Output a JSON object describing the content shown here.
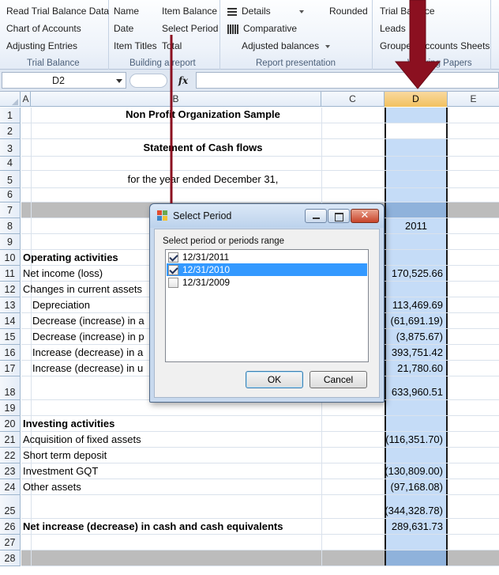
{
  "ribbon": {
    "groups": [
      {
        "label": "Trial Balance",
        "items": [
          "Read Trial Balance Data",
          "Chart of Accounts",
          "Adjusting Entries"
        ]
      },
      {
        "label": "Building a report",
        "col1": [
          "Name",
          "Date",
          "Item Titles"
        ],
        "col2": [
          "Item Balance",
          "Select Period",
          "Total"
        ]
      },
      {
        "label": "Report presentation",
        "items": [
          "Details",
          "Comparative",
          "Adjusted balances"
        ],
        "rounded": "Rounded"
      },
      {
        "label": "Working Papers",
        "items": [
          "Trial Balance",
          "Leads",
          "Grouped Accounts Sheets"
        ]
      }
    ],
    "icons": {
      "details": "lines-icon",
      "comparative": "bars-icon"
    }
  },
  "formula_bar": {
    "name_box": "D2",
    "fx_label": "fx",
    "formula": ""
  },
  "grid": {
    "columns": [
      "A",
      "B",
      "C",
      "D",
      "E"
    ],
    "selected_column": "D",
    "rows": [
      {
        "n": "1",
        "b": "Non Profit Organization Sample",
        "b_style": "center-bold",
        "d": ""
      },
      {
        "n": "2",
        "b": "",
        "d": ""
      },
      {
        "n": "3",
        "b": "Statement of Cash flows",
        "b_style": "center-bold",
        "d": ""
      },
      {
        "n": "4",
        "b": "",
        "d": ""
      },
      {
        "n": "5",
        "b": "for the year ended December 31,",
        "b_style": "center",
        "d": ""
      },
      {
        "n": "6",
        "b": "",
        "d": ""
      },
      {
        "n": "7",
        "b": "",
        "d": ""
      },
      {
        "n": "8",
        "b": "",
        "d": "2011"
      },
      {
        "n": "9",
        "b": "",
        "d": ""
      },
      {
        "n": "10",
        "b": "Operating activities",
        "b_style": "bold",
        "d": ""
      },
      {
        "n": "11",
        "b": "Net income (loss)",
        "d": "170,525.66"
      },
      {
        "n": "12",
        "b": "Changes in current assets",
        "d": ""
      },
      {
        "n": "13",
        "b": "Depreciation",
        "b_style": "indent",
        "d": "113,469.69"
      },
      {
        "n": "14",
        "b": "Decrease (increase) in a",
        "b_style": "indent",
        "d": "(61,691.19)"
      },
      {
        "n": "15",
        "b": "Decrease (increase) in p",
        "b_style": "indent",
        "d": "(3,875.67)"
      },
      {
        "n": "16",
        "b": "Increase (decrease) in a",
        "b_style": "indent",
        "d": "393,751.42"
      },
      {
        "n": "17",
        "b": "Increase (decrease) in u",
        "b_style": "indent",
        "d": "21,780.60"
      },
      {
        "n": "18",
        "b": "",
        "d": "633,960.51"
      },
      {
        "n": "19",
        "b": "",
        "d": ""
      },
      {
        "n": "20",
        "b": "Investing activities",
        "b_style": "bold",
        "d": ""
      },
      {
        "n": "21",
        "b": "Acquisition of fixed assets",
        "d": "(116,351.70)"
      },
      {
        "n": "22",
        "b": "Short term deposit",
        "d": ""
      },
      {
        "n": "23",
        "b": "Investment GQT",
        "d": "(130,809.00)"
      },
      {
        "n": "24",
        "b": "Other assets",
        "d": "(97,168.08)"
      },
      {
        "n": "25",
        "b": "",
        "d": "(344,328.78)"
      },
      {
        "n": "26",
        "b": "Net increase (decrease) in cash and cash equivalents",
        "b_style": "bold",
        "d": "289,631.73"
      },
      {
        "n": "27",
        "b": "",
        "d": ""
      },
      {
        "n": "28",
        "b": "",
        "d": ""
      }
    ]
  },
  "dialog": {
    "title": "Select Period",
    "prompt": "Select period or periods range",
    "options": [
      {
        "label": "12/31/2011",
        "checked": true,
        "highlighted": false
      },
      {
        "label": "12/31/2010",
        "checked": true,
        "highlighted": true
      },
      {
        "label": "12/31/2009",
        "checked": false,
        "highlighted": false
      }
    ],
    "ok_label": "OK",
    "cancel_label": "Cancel",
    "close_glyph": "✕"
  },
  "colors": {
    "selection_fill": "#c5dcf7",
    "annotation": "#8b1020",
    "list_highlight": "#3399ff",
    "title_band": "#bcbcbc"
  }
}
